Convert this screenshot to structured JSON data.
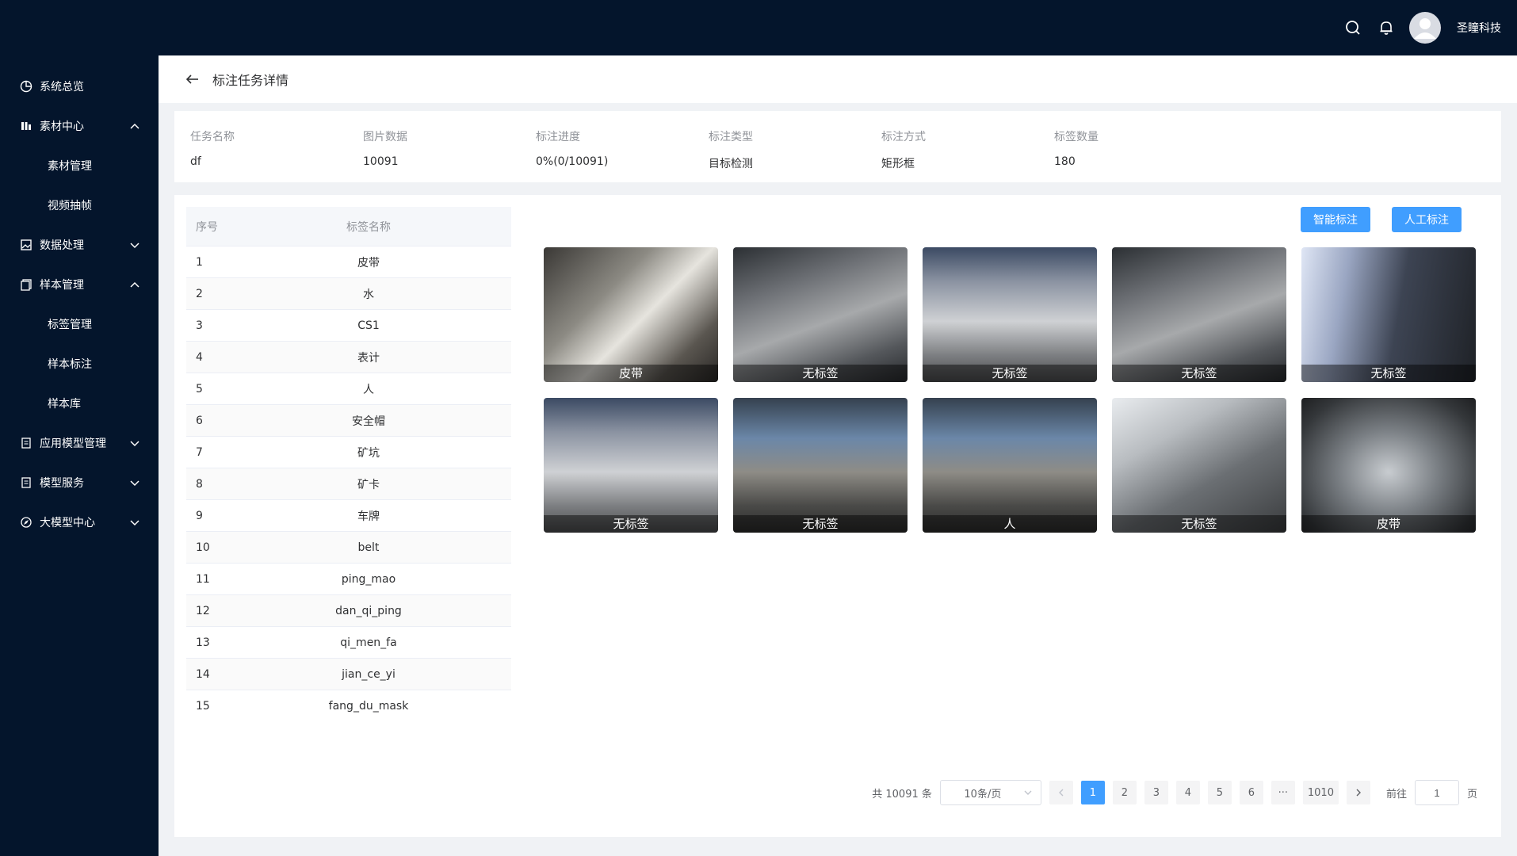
{
  "topbar": {
    "username": "圣瞳科技",
    "icons": [
      "search-icon",
      "bell-icon",
      "user-avatar-icon"
    ]
  },
  "sidebar": {
    "items": [
      {
        "label": "系统总览",
        "icon": "dashboard-icon"
      },
      {
        "label": "素材中心",
        "icon": "chart-bars-icon",
        "expanded": true
      },
      {
        "label": "素材管理"
      },
      {
        "label": "视频抽帧"
      },
      {
        "label": "数据处理",
        "icon": "image-icon",
        "expanded": false
      },
      {
        "label": "样本管理",
        "icon": "copy-icon",
        "expanded": true
      },
      {
        "label": "标签管理"
      },
      {
        "label": "样本标注"
      },
      {
        "label": "样本库"
      },
      {
        "label": "应用模型管理",
        "icon": "document-icon",
        "expanded": false
      },
      {
        "label": "模型服务",
        "icon": "document-icon",
        "expanded": false
      },
      {
        "label": "大模型中心",
        "icon": "compass-icon",
        "expanded": false
      }
    ]
  },
  "header": {
    "title": "标注任务详情"
  },
  "info": {
    "task_name": {
      "label": "任务名称",
      "value": "df"
    },
    "image_data": {
      "label": "图片数据",
      "value": "10091"
    },
    "progress": {
      "label": "标注进度",
      "value": "0%(0/10091)"
    },
    "annot_type": {
      "label": "标注类型",
      "value": "目标检测"
    },
    "annot_method": {
      "label": "标注方式",
      "value": "矩形框"
    },
    "label_count": {
      "label": "标签数量",
      "value": "180"
    }
  },
  "table": {
    "headers": {
      "index": "序号",
      "name": "标签名称"
    },
    "rows": [
      {
        "index": "1",
        "name": "皮带"
      },
      {
        "index": "2",
        "name": "水"
      },
      {
        "index": "3",
        "name": "CS1"
      },
      {
        "index": "4",
        "name": "表计"
      },
      {
        "index": "5",
        "name": "人"
      },
      {
        "index": "6",
        "name": "安全帽"
      },
      {
        "index": "7",
        "name": "矿坑"
      },
      {
        "index": "8",
        "name": "矿卡"
      },
      {
        "index": "9",
        "name": "车牌"
      },
      {
        "index": "10",
        "name": "belt"
      },
      {
        "index": "11",
        "name": "ping_mao"
      },
      {
        "index": "12",
        "name": "dan_qi_ping"
      },
      {
        "index": "13",
        "name": "qi_men_fa"
      },
      {
        "index": "14",
        "name": "jian_ce_yi"
      },
      {
        "index": "15",
        "name": "fang_du_mask"
      }
    ]
  },
  "buttons": {
    "smart": "智能标注",
    "manual": "人工标注"
  },
  "thumbnails": [
    {
      "caption": "皮带",
      "scene": "office"
    },
    {
      "caption": "无标签",
      "scene": "room"
    },
    {
      "caption": "无标签",
      "scene": "control"
    },
    {
      "caption": "无标签",
      "scene": "room"
    },
    {
      "caption": "无标签",
      "scene": "bright"
    },
    {
      "caption": "无标签",
      "scene": "control"
    },
    {
      "caption": "无标签",
      "scene": "plant"
    },
    {
      "caption": "人",
      "scene": "plant"
    },
    {
      "caption": "无标签",
      "scene": "industry"
    },
    {
      "caption": "皮带",
      "scene": "tunnel"
    }
  ],
  "pagination": {
    "total_text": "共 10091 条",
    "page_size": "10条/页",
    "pages": [
      "1",
      "2",
      "3",
      "4",
      "5",
      "6"
    ],
    "ellipsis": "···",
    "last_page": "1010",
    "current": "1",
    "goto_label": "前往",
    "goto_value": "1",
    "page_unit": "页"
  },
  "colors": {
    "sidebar_bg": "#04152c",
    "primary": "#409eff",
    "page_bg": "#f0f2f5"
  }
}
